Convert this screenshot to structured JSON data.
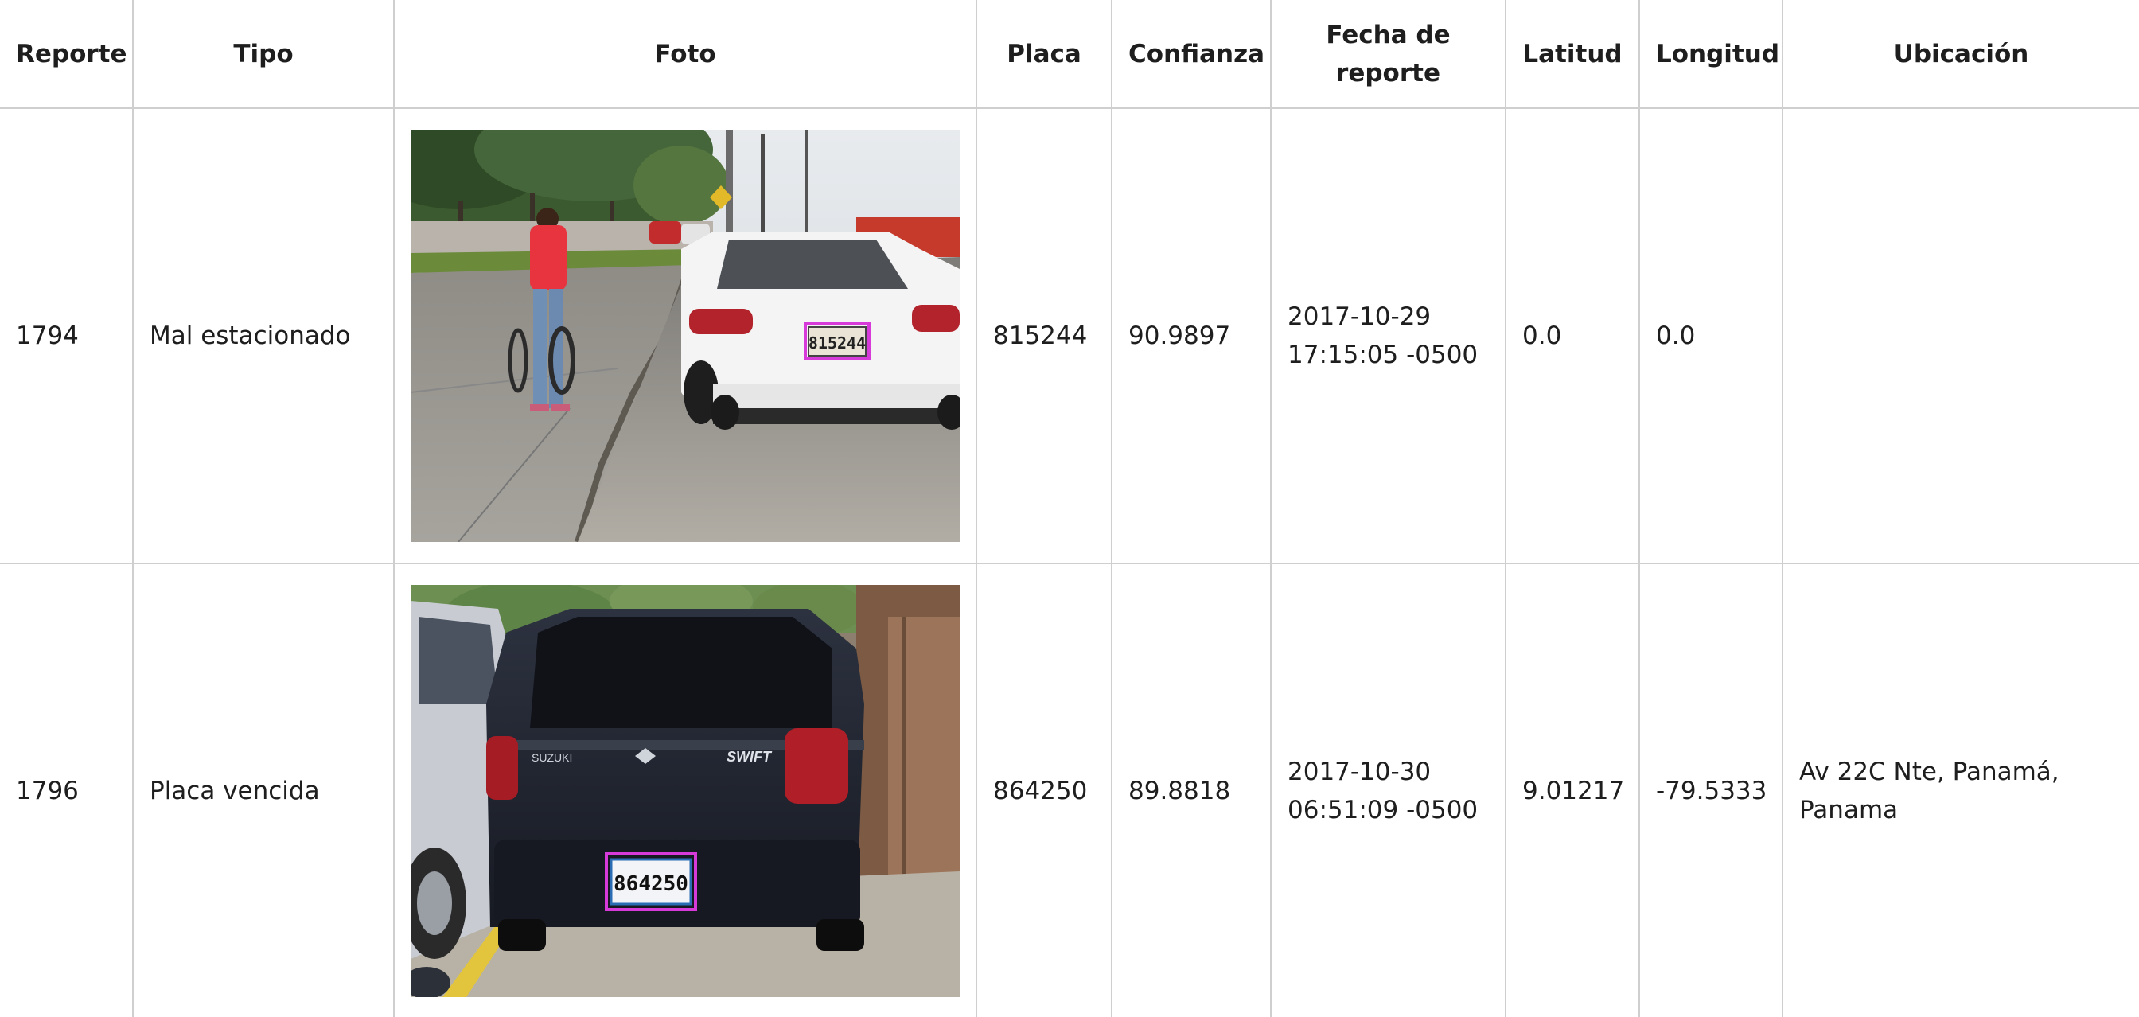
{
  "table": {
    "headers": {
      "reporte": "Reporte",
      "tipo": "Tipo",
      "foto": "Foto",
      "placa": "Placa",
      "confianza": "Confianza",
      "fecha_line1": "Fecha de",
      "fecha_line2": "reporte",
      "latitud": "Latitud",
      "longitud": "Longitud",
      "ubicacion": "Ubicación"
    },
    "rows": [
      {
        "reporte": "1794",
        "tipo": "Mal estacionado",
        "photo_plate": "815244",
        "placa": "815244",
        "confianza": "90.9897",
        "fecha_line1": "2017-10-29",
        "fecha_line2": "17:15:05 -0500",
        "latitud": "0.0",
        "longitud": "0.0",
        "ubicacion_line1": "",
        "ubicacion_line2": ""
      },
      {
        "reporte": "1796",
        "tipo": "Placa vencida",
        "photo_plate": "864250",
        "photo_badge": "SWIFT",
        "placa": "864250",
        "confianza": "89.8818",
        "fecha_line1": "2017-10-30",
        "fecha_line2": "06:51:09 -0500",
        "latitud": "9.01217",
        "longitud": "-79.5333",
        "ubicacion_line1": "Av 22C Nte, Panamá,",
        "ubicacion_line2": "Panama"
      }
    ]
  },
  "colors": {
    "border": "#cfcfcf",
    "plate_highlight": "#d63ad8",
    "text": "#1e1e1e"
  }
}
